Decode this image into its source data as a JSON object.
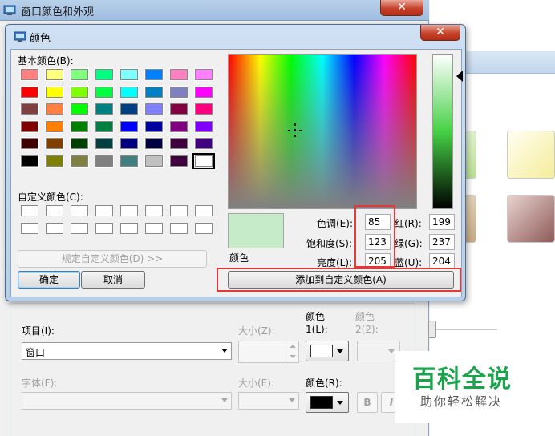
{
  "background_window": {
    "title": "窗口颜色和外观",
    "close_glyph": "✕"
  },
  "appearance": {
    "item_label": "项目(I):",
    "item_value": "窗口",
    "size_label": "大小(Z):",
    "color1_label_top": "颜色",
    "color1_label_bottom": "1(L):",
    "color2_label_top": "颜色",
    "color2_label_bottom": "2(2):",
    "font_label": "字体(F):",
    "font_size_label": "大小(E):",
    "font_color_label": "颜色(R):",
    "bold_glyph": "B",
    "italic_glyph": "I",
    "color1_value": "#ffffff",
    "font_color_value": "#000000"
  },
  "watermark": {
    "title": "百科全说",
    "subtitle": "助你轻松解决"
  },
  "color_dialog": {
    "title": "颜色",
    "close_glyph": "✕",
    "basic_colors_label": "基本颜色(B):",
    "basic_colors": [
      "#ff8080",
      "#ffff80",
      "#80ff80",
      "#00ff80",
      "#80ffff",
      "#0080ff",
      "#ff80c0",
      "#ff80ff",
      "#ff0000",
      "#ffff00",
      "#80ff00",
      "#00ff40",
      "#00ffff",
      "#0080c0",
      "#8080c0",
      "#ff00ff",
      "#804040",
      "#ff8040",
      "#00ff00",
      "#008080",
      "#004080",
      "#8080ff",
      "#800040",
      "#ff0080",
      "#800000",
      "#ff8000",
      "#008000",
      "#008040",
      "#0000ff",
      "#0000a0",
      "#800080",
      "#8000ff",
      "#400000",
      "#804000",
      "#004000",
      "#004040",
      "#000080",
      "#000040",
      "#400040",
      "#400080",
      "#000000",
      "#808000",
      "#808040",
      "#808080",
      "#408080",
      "#c0c0c0",
      "#400040",
      "#ffffff"
    ],
    "custom_colors_label": "自定义颜色(C):",
    "define_custom_button": "规定自定义颜色(D) >>",
    "ok_button": "确定",
    "cancel_button": "取消",
    "add_custom_button": "添加到自定义颜色(A)",
    "preview_label": "颜色",
    "preview_color": "#c5ebc8",
    "hue_label": "色调(E):",
    "hue_value": "85",
    "sat_label": "饱和度(S):",
    "sat_value": "123",
    "lum_label": "亮度(L):",
    "lum_value": "205",
    "red_label": "红(R):",
    "red_value": "199",
    "green_label": "绿(G):",
    "green_value": "237",
    "blue_label": "蓝(U):",
    "blue_value": "204"
  }
}
